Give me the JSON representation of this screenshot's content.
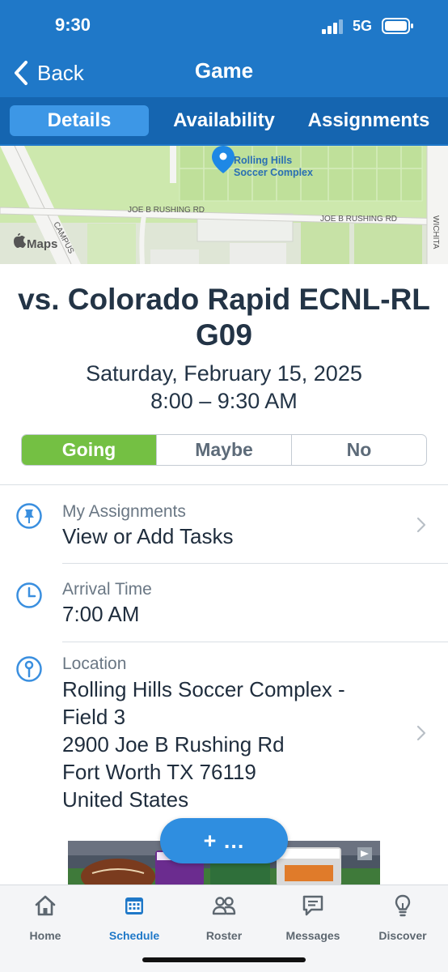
{
  "status": {
    "time": "9:30",
    "network": "5G"
  },
  "header": {
    "back_label": "Back",
    "title": "Game"
  },
  "tabs": [
    {
      "label": "Details",
      "active": true
    },
    {
      "label": "Availability",
      "active": false
    },
    {
      "label": "Assignments",
      "active": false
    }
  ],
  "map": {
    "venue_label_line1": "Rolling Hills",
    "venue_label_line2": "Soccer Complex",
    "road_label_1": "JOE B RUSHING RD",
    "road_label_2": "JOE B RUSHING RD",
    "road_label_campus": "CAMPUS",
    "road_label_wichita": "WICHITA",
    "attribution": "Maps"
  },
  "game": {
    "title": "vs. Colorado Rapid ECNL-RL G09",
    "date": "Saturday, February 15, 2025",
    "time": "8:00 – 9:30 AM"
  },
  "rsvp": {
    "going": "Going",
    "maybe": "Maybe",
    "no": "No",
    "selected": "going"
  },
  "assignments": {
    "caption": "My Assignments",
    "value": "View or Add Tasks"
  },
  "arrival": {
    "caption": "Arrival Time",
    "value": "7:00 AM"
  },
  "location": {
    "caption": "Location",
    "line1": "Rolling Hills Soccer Complex -",
    "line2": "Field 3",
    "line3": "2900 Joe B Rushing Rd",
    "line4": "Fort Worth TX 76119",
    "line5": "United States"
  },
  "fab": {
    "label": "+ ..."
  },
  "bottom_nav": [
    {
      "label": "Home",
      "icon": "home-icon",
      "active": false
    },
    {
      "label": "Schedule",
      "icon": "calendar-icon",
      "active": true
    },
    {
      "label": "Roster",
      "icon": "people-icon",
      "active": false
    },
    {
      "label": "Messages",
      "icon": "chat-icon",
      "active": false
    },
    {
      "label": "Discover",
      "icon": "lightbulb-icon",
      "active": false
    }
  ],
  "colors": {
    "brand_blue": "#1f78c8",
    "tab_bar": "#1565b0",
    "tab_active": "#3d97e6",
    "going_green": "#74c043",
    "icon_blue": "#3a8fdf"
  }
}
